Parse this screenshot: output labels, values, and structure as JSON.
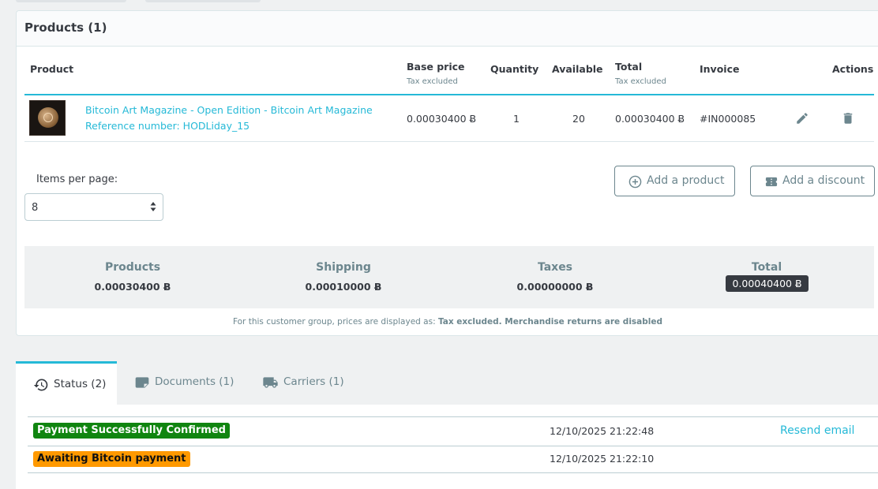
{
  "products_card": {
    "title": "Products (1)",
    "columns": {
      "product": "Product",
      "base_price": "Base price",
      "base_price_sub": "Tax excluded",
      "quantity": "Quantity",
      "available": "Available",
      "total": "Total",
      "total_sub": "Tax excluded",
      "invoice": "Invoice",
      "actions": "Actions"
    },
    "rows": [
      {
        "name": "Bitcoin Art Magazine - Open Edition - Bitcoin Art Magazine",
        "reference": "Reference number: HODLiday_15",
        "base_price": "0.00030400 Ƀ",
        "quantity": "1",
        "available": "20",
        "total": "0.00030400 Ƀ",
        "invoice": "#IN000085",
        "edit_icon": "pencil-icon",
        "delete_icon": "trash-icon"
      }
    ],
    "pagination": {
      "items_per_page_label": "Items per page:",
      "items_per_page_value": "8"
    },
    "buttons": {
      "add_product": "Add a product",
      "add_product_icon": "plus-circle-icon",
      "add_discount": "Add a discount",
      "add_discount_icon": "ticket-icon"
    },
    "totals": {
      "products_label": "Products",
      "products_value": "0.00030400 Ƀ",
      "shipping_label": "Shipping",
      "shipping_value": "0.00010000 Ƀ",
      "taxes_label": "Taxes",
      "taxes_value": "0.00000000 Ƀ",
      "total_label": "Total",
      "total_value": "0.00040400 Ƀ"
    },
    "note": {
      "prefix": "For this customer group, prices are displayed as: ",
      "tax_mode": "Tax excluded",
      "returns": ". Merchandise returns are disabled"
    }
  },
  "tabs": [
    {
      "label": "Status (2)",
      "icon": "history-icon",
      "active": true
    },
    {
      "label": "Documents (1)",
      "icon": "folder-icon",
      "active": false
    },
    {
      "label": "Carriers (1)",
      "icon": "truck-icon",
      "active": false
    }
  ],
  "status_history": [
    {
      "status": "Payment Successfully Confirmed",
      "color": "#108510",
      "date": "12/10/2025 21:22:48",
      "action": "Resend email"
    },
    {
      "status": "Awaiting Bitcoin payment",
      "color": "#ff9900",
      "date": "12/10/2025 21:22:10",
      "action": ""
    }
  ],
  "colors": {
    "accent": "#25b9d7",
    "text": "#363a41",
    "muted": "#6c868e"
  }
}
